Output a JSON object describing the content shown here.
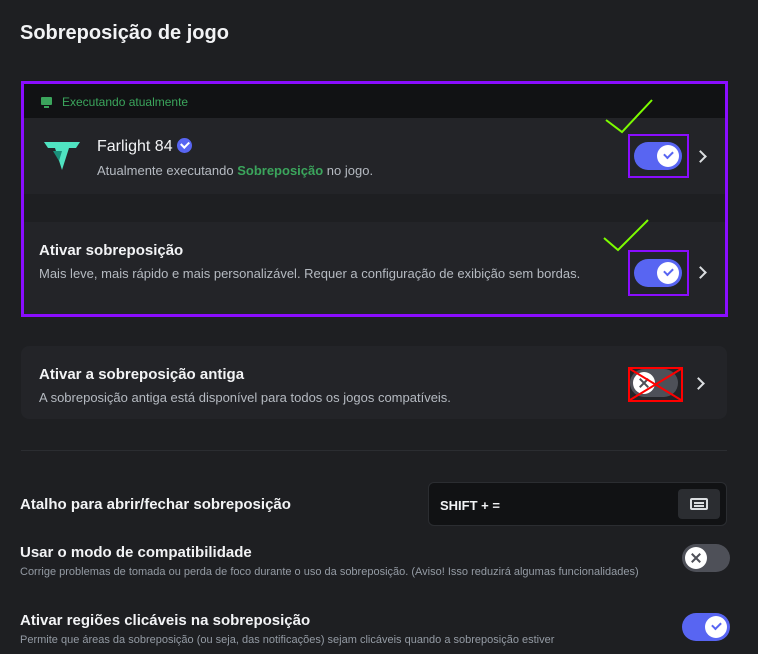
{
  "page": {
    "title": "Sobreposição de jogo"
  },
  "running": {
    "header_label": "Executando atualmente",
    "game": {
      "name": "Farlight 84",
      "subtitle_prefix": "Atualmente executando ",
      "subtitle_highlight": "Sobreposição",
      "subtitle_suffix": " no jogo.",
      "overlay_enabled": true
    },
    "enable_overlay": {
      "title": "Ativar sobreposição",
      "description": "Mais leve, mais rápido e mais personalizável. Requer a configuração de exibição sem bordas.",
      "enabled": true
    }
  },
  "legacy": {
    "title": "Ativar a sobreposição antiga",
    "description": "A sobreposição antiga está disponível para todos os jogos compatíveis.",
    "enabled": false
  },
  "settings": {
    "hotkey": {
      "label": "Atalho para abrir/fechar sobreposição",
      "value": "SHIFT + ="
    },
    "compat": {
      "title": "Usar o modo de compatibilidade",
      "description": "Corrige problemas de tomada ou perda de foco durante o uso da sobreposição. (Aviso! Isso reduzirá algumas funcionalidades)",
      "enabled": false
    },
    "clickable": {
      "title": "Ativar regiões clicáveis na sobreposição",
      "description": "Permite que áreas da sobreposição (ou seja, das notificações) sejam clicáveis quando a sobreposição estiver",
      "enabled": true
    }
  },
  "colors": {
    "accent": "#5865f2",
    "green": "#3ba55c",
    "highlight_border": "#8a0dff",
    "annotation_red": "#ff0000",
    "annotation_green": "#7cfc00"
  },
  "icons": [
    "monitor-icon",
    "game-logo-icon",
    "verified-badge-icon",
    "chevron-right-icon",
    "keyboard-icon",
    "check-icon",
    "x-icon"
  ]
}
